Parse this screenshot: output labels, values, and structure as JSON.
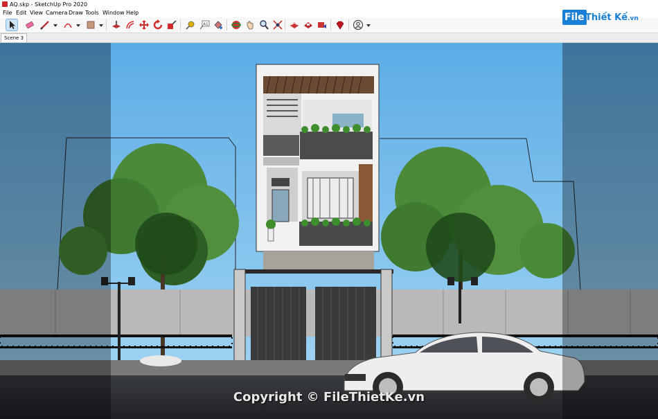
{
  "window": {
    "title": "AQ.skp - SketchUp Pro 2020"
  },
  "menu": [
    "File",
    "Edit",
    "View",
    "Camera",
    "Draw",
    "Tools",
    "Window",
    "Help"
  ],
  "toolbar": {
    "tools": [
      "select-tool",
      "eraser-tool",
      "line-tool",
      "arc-tool",
      "shape-tool",
      "push-pull-tool",
      "offset-tool",
      "move-tool",
      "rotate-tool",
      "scale-tool",
      "tape-measure-tool",
      "text-tool",
      "paint-bucket-tool",
      "orbit-tool",
      "pan-tool",
      "zoom-tool",
      "zoom-extents-tool",
      "warehouse-tool",
      "extension-warehouse-tool",
      "share-model-tool",
      "ruby-tool",
      "account-tool"
    ]
  },
  "watermark": {
    "brand_file": "File",
    "brand_rest": "Thiết Kế",
    "brand_tld": ".vn"
  },
  "scenes": {
    "active": "Scene 3"
  },
  "viewport": {
    "copyright": "Copyright © FileThietKe.vn"
  },
  "colors": {
    "sky": "#7ec0ea",
    "brand": "#1a7fd6"
  }
}
